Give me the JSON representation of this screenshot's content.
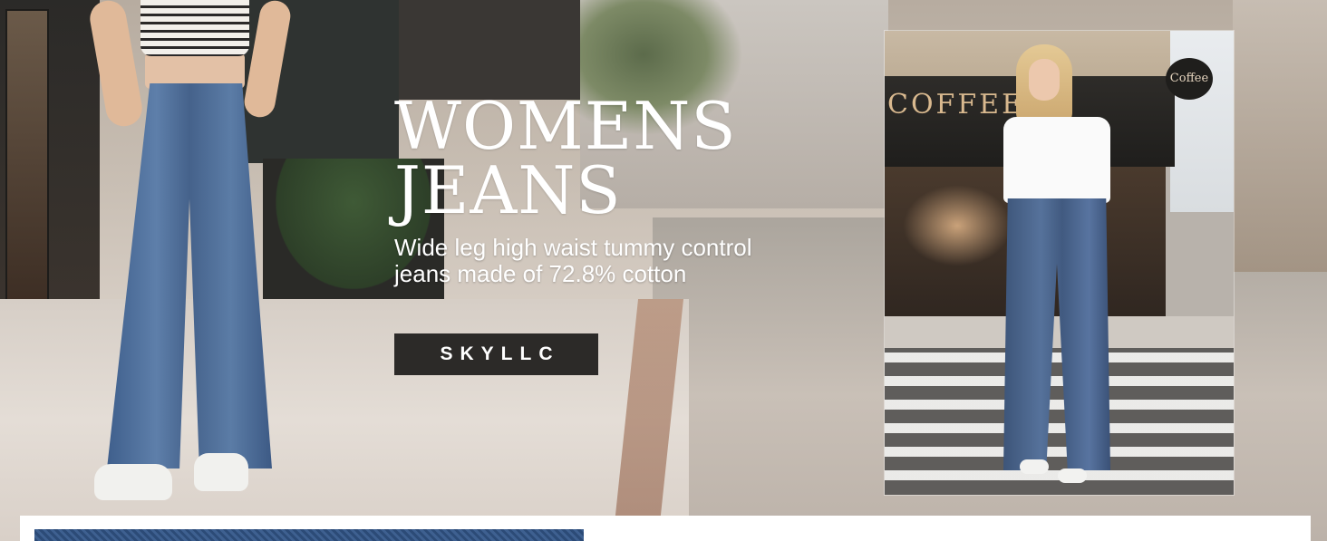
{
  "banner": {
    "headline_line1": "WOMENS",
    "headline_line2": "JEANS",
    "subhead_line1": "Wide leg high waist tummy control",
    "subhead_line2": "jeans made of 72.8% cotton",
    "brand_button_label": "SKYLLC"
  },
  "photo_inset": {
    "storefront_text": "COFFEE",
    "hanging_sign_text": "Coffee"
  },
  "colors": {
    "headline_text": "#ffffff",
    "button_background": "#2c2a28",
    "button_text": "#ffffff",
    "bottom_strip": "#ffffff"
  }
}
